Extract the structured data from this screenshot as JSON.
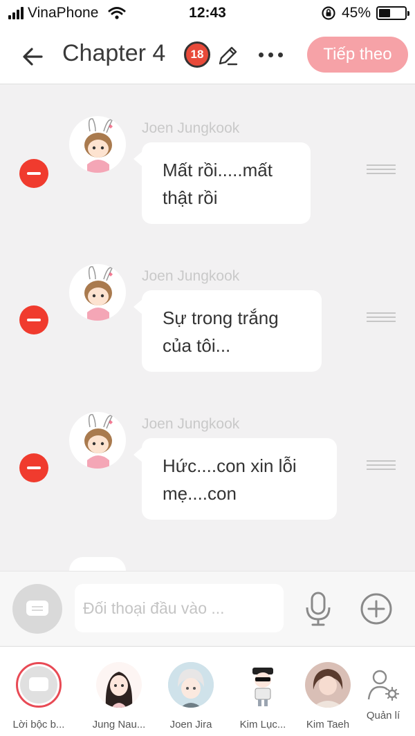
{
  "status_bar": {
    "carrier": "VinaPhone",
    "time": "12:43",
    "battery_percent": "45%",
    "battery_level": 0.45
  },
  "header": {
    "title": "Chapter 4",
    "age_badge": "18",
    "next_label": "Tiếp theo",
    "accent_color": "#f6a2a7"
  },
  "messages": [
    {
      "sender": "Joen Jungkook",
      "lines": [
        "Mất rồi.....mất",
        "thật rồi"
      ]
    },
    {
      "sender": "Joen Jungkook",
      "lines": [
        "Sự trong trắng",
        "của tôi..."
      ]
    },
    {
      "sender": "Joen Jungkook",
      "lines": [
        "Hức....con xin lỗi",
        "mẹ....con"
      ]
    }
  ],
  "composer": {
    "placeholder": "Đối thoại đầu vào ..."
  },
  "characters": [
    {
      "name": "Lời bộc b...",
      "icon": "narration-icon"
    },
    {
      "name": "Jung Nau...",
      "icon": "avatar"
    },
    {
      "name": "Joen Jira",
      "icon": "avatar"
    },
    {
      "name": "Kim Lục...",
      "icon": "avatar"
    },
    {
      "name": "Kim Taeh",
      "icon": "avatar"
    },
    {
      "name": "Quản lí",
      "icon": "manage-user-icon"
    }
  ],
  "colors": {
    "delete": "#f03b2e",
    "background": "#f2f1f2",
    "sender_name": "#c9c9c9"
  }
}
